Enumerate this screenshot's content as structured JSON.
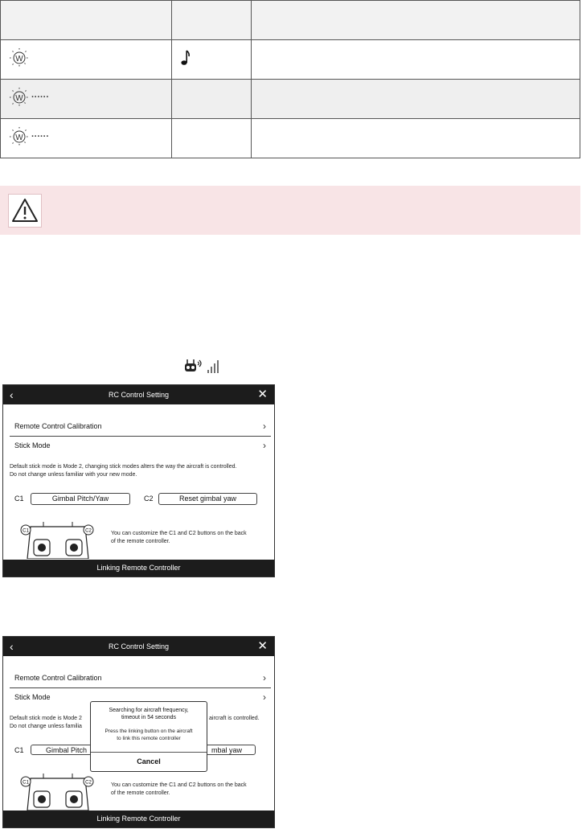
{
  "status_table": {
    "header": [
      "",
      "",
      ""
    ],
    "rows": [
      {
        "led": "white-led-icon",
        "pattern": "",
        "sound": "music-note-icon",
        "description": ""
      },
      {
        "led": "white-led-icon",
        "pattern": "······",
        "sound": "",
        "description": ""
      },
      {
        "led": "white-led-icon",
        "pattern": "······",
        "sound": "",
        "description": ""
      }
    ]
  },
  "warning": {
    "icon": "warning-triangle-icon"
  },
  "signal_icon": "rc-signal-icon",
  "screen1": {
    "title": "RC Control Setting",
    "calibration_label": "Remote Control Calibration",
    "stick_mode_label": "Stick Mode",
    "stick_desc_line1": "Default stick mode is Mode 2, changing stick modes alters the way the aircraft is controlled.",
    "stick_desc_line2": "Do not change unless familiar with your new mode.",
    "c1_label": "C1",
    "c1_value": "Gimbal Pitch/Yaw",
    "c2_label": "C2",
    "c2_value": "Reset gimbal yaw",
    "custom_line1": "You can customize the C1 and C2 buttons on the back",
    "custom_line2": "of the remote controller.",
    "footer": "Linking Remote Controller"
  },
  "screen2": {
    "title": "RC Control Setting",
    "calibration_label": "Remote Control Calibration",
    "stick_mode_label": "Stick Mode",
    "stick_desc_line1_left": "Default stick mode is Mode 2",
    "stick_desc_line1_right": "aircraft is controlled.",
    "stick_desc_line2_left": "Do not change unless familia",
    "c1_label": "C1",
    "c1_value_partial": "Gimbal Pitch",
    "c2_value_partial": "mbal yaw",
    "custom_line1": "You can customize the C1 and C2 buttons on the back",
    "custom_line2": "of the remote controller.",
    "footer": "Linking Remote Controller",
    "dialog": {
      "title_line1": "Searching for aircraft frequency,",
      "title_line2": "timeout in 54 seconds",
      "body_line1": "Press the linking button on the aircraft",
      "body_line2": "to link this remote controller",
      "cancel": "Cancel"
    }
  }
}
